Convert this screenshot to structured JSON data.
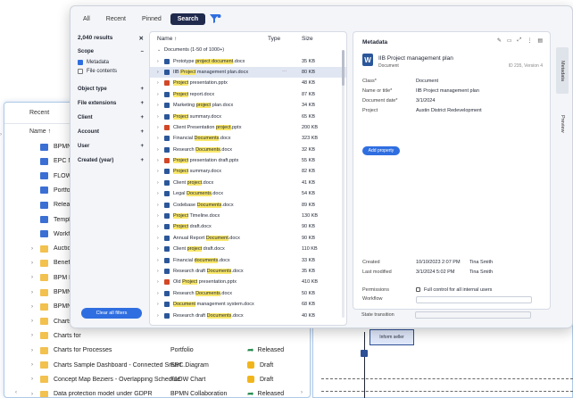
{
  "background_window": {
    "tabs": [
      "Recent"
    ],
    "column_header": "Name ↑",
    "rows": [
      {
        "name": "BPMN Not",
        "kind": "blue",
        "type": "",
        "status": "",
        "status_kind": ""
      },
      {
        "name": "EPC Notat",
        "kind": "blue",
        "type": "",
        "status": "",
        "status_kind": ""
      },
      {
        "name": "FLOW Cha",
        "kind": "blue",
        "type": "",
        "status": "",
        "status_kind": ""
      },
      {
        "name": "Portfolio F",
        "kind": "blue",
        "type": "",
        "status": "",
        "status_kind": ""
      },
      {
        "name": "Released E",
        "kind": "blue",
        "type": "",
        "status": "",
        "status_kind": ""
      },
      {
        "name": "Templates",
        "kind": "blue",
        "type": "",
        "status": "",
        "status_kind": ""
      },
      {
        "name": "Workflow",
        "kind": "blue",
        "type": "",
        "status": "",
        "status_kind": ""
      },
      {
        "name": "Auction pr",
        "kind": "folder",
        "type": "",
        "status": "",
        "status_kind": ""
      },
      {
        "name": "Benefits of",
        "kind": "folder",
        "type": "",
        "status": "",
        "status_kind": ""
      },
      {
        "name": "BPM Meth",
        "kind": "folder",
        "type": "",
        "status": "",
        "status_kind": ""
      },
      {
        "name": "BPMN Ove",
        "kind": "folder",
        "type": "",
        "status": "",
        "status_kind": ""
      },
      {
        "name": "BPMN Sym",
        "kind": "folder",
        "type": "",
        "status": "",
        "status_kind": ""
      },
      {
        "name": "Charts for",
        "kind": "folder",
        "type": "",
        "status": "",
        "status_kind": ""
      },
      {
        "name": "Charts for",
        "kind": "folder",
        "type": "",
        "status": "",
        "status_kind": ""
      },
      {
        "name": "Charts for Processes",
        "kind": "folder",
        "type": "Portfolio",
        "status": "Released",
        "status_kind": "released"
      },
      {
        "name": "Charts Sample Dashboard - Connected Smart ...",
        "kind": "folder",
        "type": "EPC Diagram",
        "status": "Draft",
        "status_kind": "draft"
      },
      {
        "name": "Concept Map Beziers - Overlapping Schedule",
        "kind": "folder",
        "type": "FLOW Chart",
        "status": "Draft",
        "status_kind": "draft"
      },
      {
        "name": "Data protection model under GDPR",
        "kind": "folder",
        "type": "BPMN Collaboration",
        "status": "Released",
        "status_kind": "released"
      }
    ]
  },
  "diagram": {
    "box_label": "Inform seller"
  },
  "overlay": {
    "tabs": [
      {
        "label": "All",
        "active": false
      },
      {
        "label": "Recent",
        "active": false
      },
      {
        "label": "Pinned",
        "active": false
      },
      {
        "label": "Search",
        "active": true
      }
    ],
    "filters": {
      "results": "2,040 results",
      "scope_label": "Scope",
      "scope_options": [
        {
          "label": "Metadata",
          "checked": true
        },
        {
          "label": "File contents",
          "checked": false
        }
      ],
      "groups": [
        "Object type",
        "File extensions",
        "Client",
        "Account",
        "User",
        "Created (year)"
      ],
      "clear_label": "Clear all filters"
    },
    "list": {
      "col_name": "Name ↑",
      "col_type": "Type",
      "col_size": "Size",
      "group_label": "Documents (1-50 of 1000+)",
      "rows": [
        {
          "pre": "Prototype ",
          "hl": "project document",
          "post": ".docx",
          "ext": "docx",
          "size": "35 KB",
          "selected": false
        },
        {
          "pre": "IIB ",
          "hl": "Project",
          "post": " management plan.docx",
          "ext": "docx",
          "size": "80 KB",
          "selected": true
        },
        {
          "pre": "",
          "hl": "Project",
          "post": " presentation.pptx",
          "ext": "pptx",
          "size": "48 KB",
          "selected": false
        },
        {
          "pre": "",
          "hl": "Project",
          "post": " report.docx",
          "ext": "docx",
          "size": "87 KB",
          "selected": false
        },
        {
          "pre": "Marketing ",
          "hl": "project",
          "post": " plan.docx",
          "ext": "docx",
          "size": "34 KB",
          "selected": false
        },
        {
          "pre": "",
          "hl": "Project",
          "post": " summary.docx",
          "ext": "docx",
          "size": "65 KB",
          "selected": false
        },
        {
          "pre": "Client Presentation ",
          "hl": "project",
          "post": ".pptx",
          "ext": "pptx",
          "size": "200 KB",
          "selected": false
        },
        {
          "pre": "Financial ",
          "hl": "Documents",
          "post": ".docx",
          "ext": "docx",
          "size": "323 KB",
          "selected": false
        },
        {
          "pre": "Research ",
          "hl": "Documents",
          "post": ".docx",
          "ext": "docx",
          "size": "32 KB",
          "selected": false
        },
        {
          "pre": "",
          "hl": "Project",
          "post": " presentation draft.pptx",
          "ext": "pptx",
          "size": "55 KB",
          "selected": false
        },
        {
          "pre": "",
          "hl": "Project",
          "post": " summary.docx",
          "ext": "docx",
          "size": "82 KB",
          "selected": false
        },
        {
          "pre": "Client ",
          "hl": "project",
          "post": ".docx",
          "ext": "docx",
          "size": "41 KB",
          "selected": false
        },
        {
          "pre": "Legal ",
          "hl": "Documents",
          "post": ".docx",
          "ext": "docx",
          "size": "54 KB",
          "selected": false
        },
        {
          "pre": "Codebase ",
          "hl": "Documents",
          "post": ".docx",
          "ext": "docx",
          "size": "89 KB",
          "selected": false
        },
        {
          "pre": "",
          "hl": "Project",
          "post": " Timeline.docx",
          "ext": "docx",
          "size": "130 KB",
          "selected": false
        },
        {
          "pre": "",
          "hl": "Project",
          "post": " draft.docx",
          "ext": "docx",
          "size": "90 KB",
          "selected": false
        },
        {
          "pre": "Annual Report ",
          "hl": "Document",
          "post": ".docx",
          "ext": "docx",
          "size": "90 KB",
          "selected": false
        },
        {
          "pre": "Client ",
          "hl": "project",
          "post": " draft.docx",
          "ext": "docx",
          "size": "110 KB",
          "selected": false
        },
        {
          "pre": "Financial ",
          "hl": "documents",
          "post": ".docx",
          "ext": "docx",
          "size": "33 KB",
          "selected": false
        },
        {
          "pre": "Research draft ",
          "hl": "Documents",
          "post": ".docx",
          "ext": "docx",
          "size": "35 KB",
          "selected": false
        },
        {
          "pre": "Old ",
          "hl": "Project",
          "post": " presentation.pptx",
          "ext": "pptx",
          "size": "410 KB",
          "selected": false
        },
        {
          "pre": "Research ",
          "hl": "Documents",
          "post": ".docx",
          "ext": "docx",
          "size": "50 KB",
          "selected": false
        },
        {
          "pre": "",
          "hl": "Document",
          "post": " management system.docx",
          "ext": "docx",
          "size": "68 KB",
          "selected": false
        },
        {
          "pre": "Research draft ",
          "hl": "Documents",
          "post": ".docx",
          "ext": "docx",
          "size": "40 KB",
          "selected": false
        }
      ]
    },
    "metadata": {
      "title": "Metadata",
      "doc_name": "IIB Project management plan",
      "doc_type": "Document",
      "version": "ID 235, Version 4",
      "fields": [
        {
          "k": "Class*",
          "v": "Document"
        },
        {
          "k": "Name or title*",
          "v": "IIB Project management plan"
        },
        {
          "k": "Document date*",
          "v": "3/1/2024"
        },
        {
          "k": "Project",
          "v": "Austin District Redevelopment"
        }
      ],
      "add_property": "Add property",
      "created_label": "Created",
      "created_value": "10/10/2023 2:07 PM",
      "created_user": "Tina Smith",
      "modified_label": "Last modified",
      "modified_value": "3/1/2024 5:02 PM",
      "modified_user": "Tina Smith",
      "permissions_label": "Permissions",
      "permissions_value": "Full control for all internal users",
      "workflow_label": "Workflow",
      "state_label": "State transition"
    },
    "side_tabs": [
      {
        "label": "Metadata",
        "active": true
      },
      {
        "label": "Preview",
        "active": false
      }
    ]
  }
}
